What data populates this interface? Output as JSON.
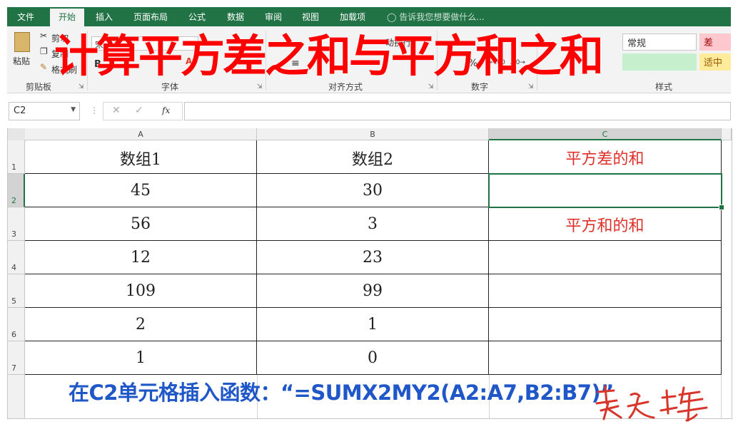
{
  "ribbon_tabs": [
    "文件",
    "开始",
    "插入",
    "页面布局",
    "公式",
    "数据",
    "审阅",
    "视图",
    "加载项"
  ],
  "tell_me": "告诉我您想要做什么...",
  "clipboard": {
    "paste": "粘贴",
    "cut": "剪切",
    "copy": "复制",
    "format_painter": "格式刷",
    "group": "剪贴板"
  },
  "font": {
    "font_name": "宋",
    "bold": "B",
    "font_color": "A",
    "group": "字体"
  },
  "alignment": {
    "wrap": "动换行",
    "group": "对齐方式"
  },
  "number": {
    "percent": "%",
    "group": "数字"
  },
  "styles": {
    "bad": "差",
    "neutral": "适中",
    "normal": "常规",
    "group": "样式"
  },
  "overlay_title": "计算平方差之和与平方和之和",
  "name_box": "C2",
  "formula_content": "",
  "columns": [
    "A",
    "B",
    "C"
  ],
  "rows": [
    "1",
    "2",
    "3",
    "4",
    "5",
    "6",
    "7"
  ],
  "cells": [
    [
      "数组1",
      "数组2",
      "平方差的和"
    ],
    [
      "45",
      "30",
      ""
    ],
    [
      "56",
      "3",
      "平方和的和"
    ],
    [
      "12",
      "23",
      ""
    ],
    [
      "109",
      "99",
      ""
    ],
    [
      "2",
      "1",
      ""
    ],
    [
      "1",
      "0",
      ""
    ]
  ],
  "caption": "在C2单元格插入函数：“=SUMX2MY2(A2:A7,B2:B7)”",
  "signature": "赵之峰",
  "colors": {
    "excel_green": "#217346",
    "title_red": "#ff0000",
    "cell_red": "#e0302a",
    "caption_blue": "#1f57c8"
  }
}
